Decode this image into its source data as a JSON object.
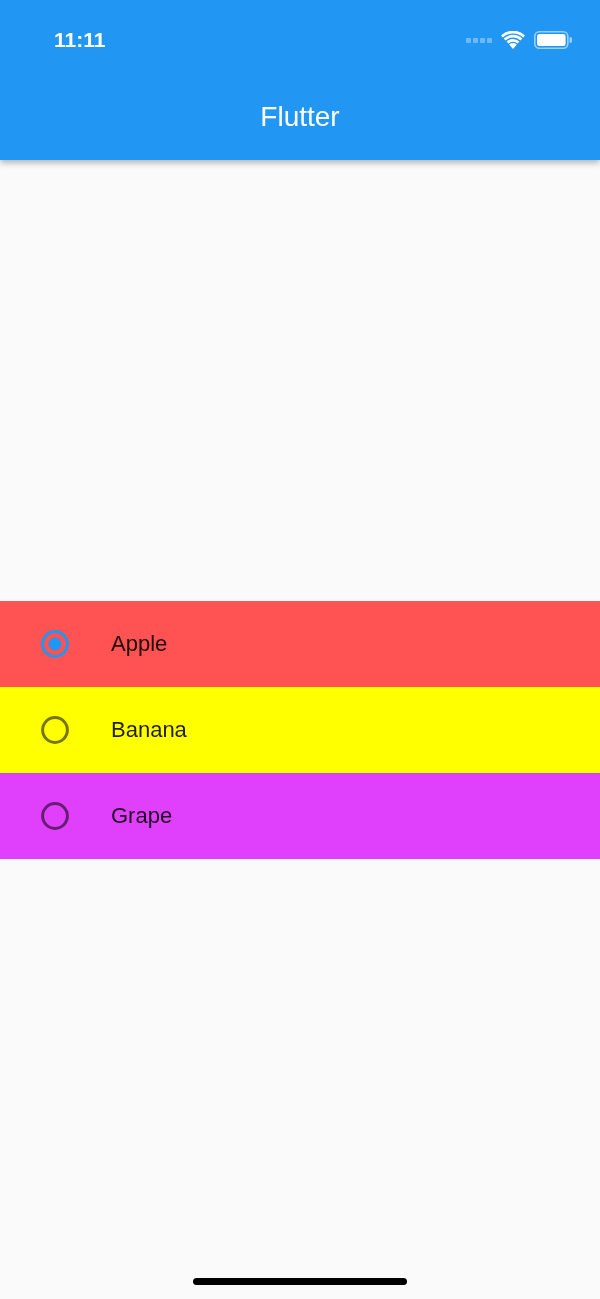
{
  "status_bar": {
    "time": "11:11"
  },
  "app_bar": {
    "title": "Flutter"
  },
  "options": [
    {
      "label": "Apple",
      "selected": true,
      "color": "#ff5252"
    },
    {
      "label": "Banana",
      "selected": false,
      "color": "#ffff00"
    },
    {
      "label": "Grape",
      "selected": false,
      "color": "#e040fb"
    }
  ]
}
